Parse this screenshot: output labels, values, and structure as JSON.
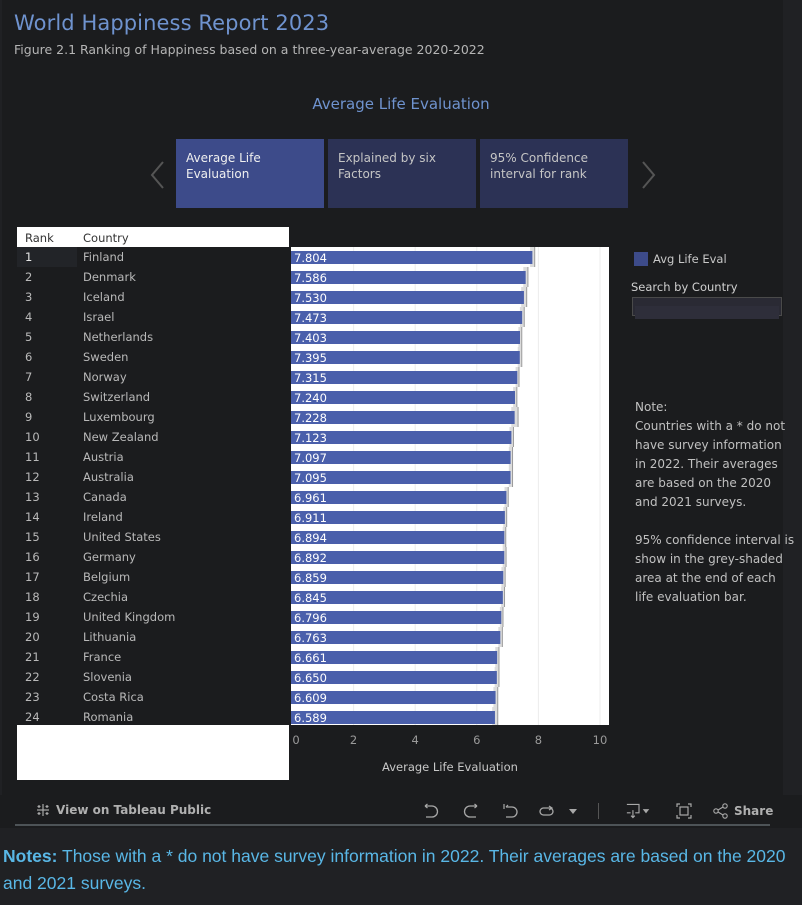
{
  "header": {
    "title": "World Happiness Report 2023",
    "subtitle": "Figure 2.1 Ranking of Happiness based on a three-year-average 2020-2022"
  },
  "section_title": "Average Life Evaluation",
  "carousel": {
    "prev_icon": "chevron-left-icon",
    "next_icon": "chevron-right-icon",
    "tabs": [
      {
        "label": "Average Life Evaluation",
        "active": true
      },
      {
        "label": "Explained by six Factors",
        "active": false
      },
      {
        "label": "95% Confidence interval for rank",
        "active": false
      }
    ]
  },
  "table": {
    "headers": {
      "rank": "Rank",
      "country": "Country"
    }
  },
  "legend": {
    "label": "Avg Life Eval",
    "color": "#3d4b8a"
  },
  "search": {
    "label": "Search by Country",
    "value": "",
    "placeholder": ""
  },
  "note": {
    "heading": "Note:",
    "text1": "Countries with a * do not have survey information in 2022. Their averages are based on the 2020 and 2021 surveys.",
    "text2": "95% confidence interval is show in the grey-shaded area at the end of each life evaluation bar."
  },
  "toolbar": {
    "view_label": "View on Tableau Public",
    "view_icon": "tableau-logo-icon",
    "icons": [
      "undo-icon",
      "redo-icon",
      "revert-icon",
      "refresh-icon",
      "dropdown-caret-icon",
      "download-icon",
      "fullscreen-icon",
      "share-icon"
    ],
    "share_label": "Share"
  },
  "footnote": {
    "bold": "Notes:",
    "text": " Those with a * do not have survey information in 2022. Their averages are based on the 2020 and 2021 surveys."
  },
  "colors": {
    "bar": "#4a5fab",
    "ci": "#d6d6d6",
    "title": "#6f93cf",
    "footnote": "#59b7e6"
  },
  "chart_data": {
    "type": "bar",
    "orientation": "horizontal",
    "title": "Average Life Evaluation",
    "xlabel": "Average Life Evaluation",
    "ylabel": "Country",
    "xlim": [
      0,
      10
    ],
    "xticks": [
      0,
      2,
      4,
      6,
      8,
      10
    ],
    "grid": true,
    "legend": {
      "entries": [
        "Avg Life Eval"
      ],
      "placement": "top-right"
    },
    "ranks": [
      1,
      2,
      3,
      4,
      5,
      6,
      7,
      8,
      9,
      10,
      11,
      12,
      13,
      14,
      15,
      16,
      17,
      18,
      19,
      20,
      21,
      22,
      23,
      24
    ],
    "categories": [
      "Finland",
      "Denmark",
      "Iceland",
      "Israel",
      "Netherlands",
      "Sweden",
      "Norway",
      "Switzerland",
      "Luxembourg",
      "New Zealand",
      "Austria",
      "Australia",
      "Canada",
      "Ireland",
      "United States",
      "Germany",
      "Belgium",
      "Czechia",
      "United Kingdom",
      "Lithuania",
      "France",
      "Slovenia",
      "Costa Rica",
      "Romania"
    ],
    "series": [
      {
        "name": "Avg Life Eval",
        "values": [
          7.804,
          7.586,
          7.53,
          7.473,
          7.403,
          7.395,
          7.315,
          7.24,
          7.228,
          7.123,
          7.097,
          7.095,
          6.961,
          6.911,
          6.894,
          6.892,
          6.859,
          6.845,
          6.796,
          6.763,
          6.661,
          6.65,
          6.609,
          6.589
        ]
      }
    ],
    "ci_95": {
      "lower": [
        7.73,
        7.51,
        7.44,
        7.4,
        7.35,
        7.33,
        7.26,
        7.18,
        7.12,
        7.06,
        7.04,
        7.04,
        6.9,
        6.86,
        6.84,
        6.84,
        6.8,
        6.79,
        6.75,
        6.7,
        6.6,
        6.58,
        6.54,
        6.5
      ],
      "upper": [
        7.88,
        7.66,
        7.62,
        7.54,
        7.46,
        7.46,
        7.37,
        7.3,
        7.34,
        7.19,
        7.16,
        7.16,
        7.02,
        6.97,
        6.94,
        6.95,
        6.92,
        6.9,
        6.85,
        6.83,
        6.72,
        6.72,
        6.68,
        6.68
      ]
    }
  }
}
